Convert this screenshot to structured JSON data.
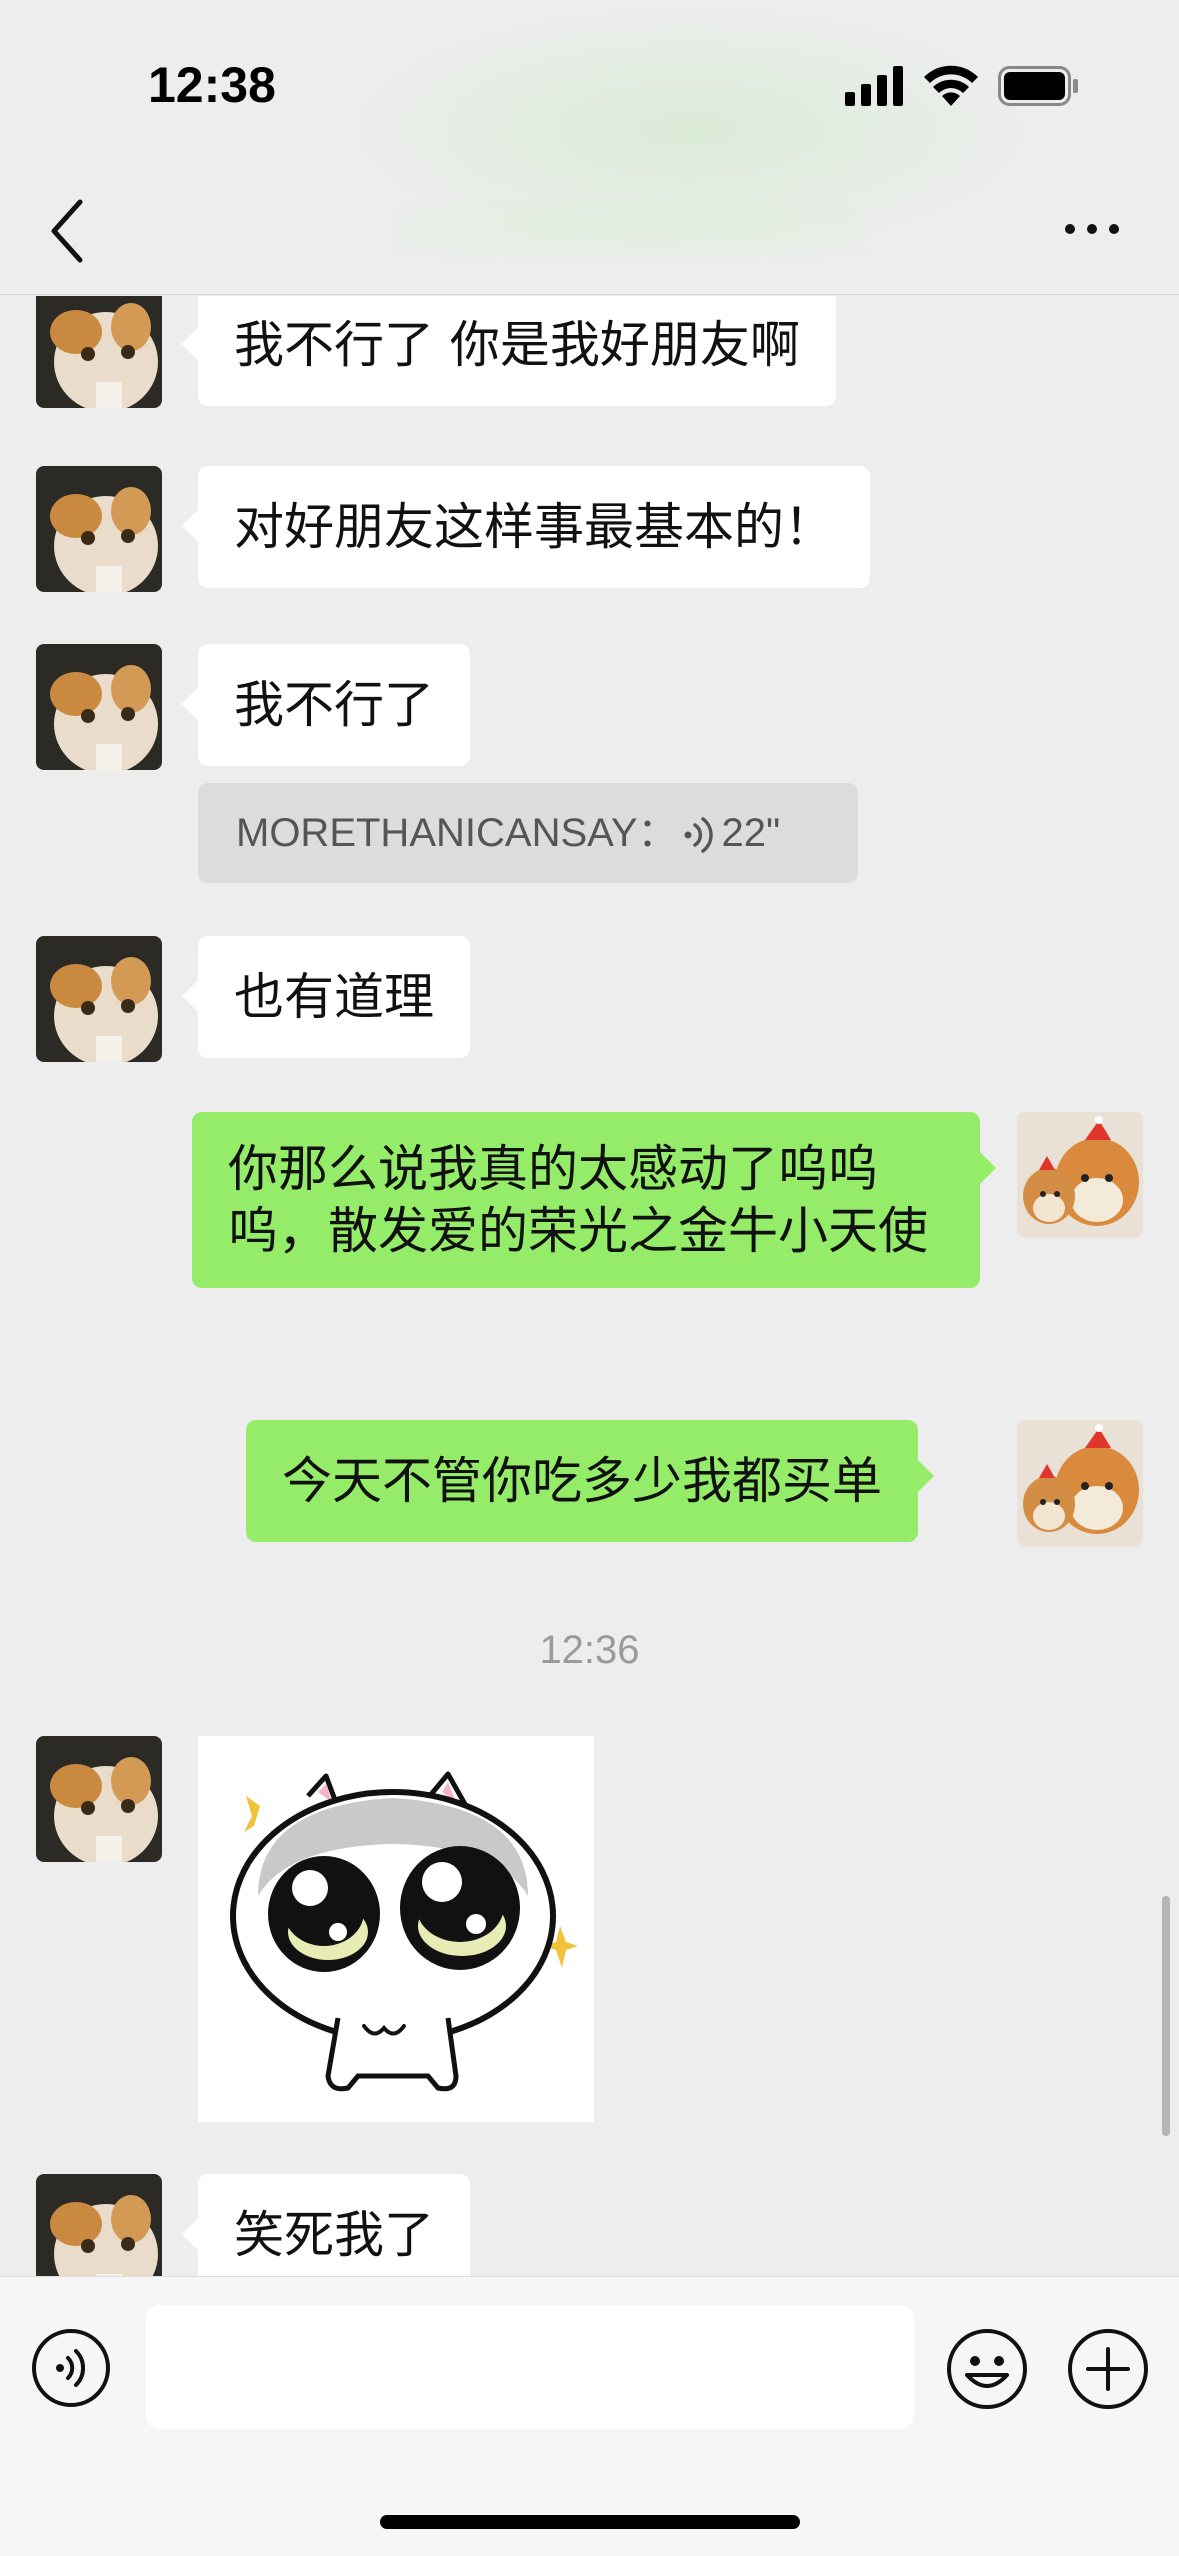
{
  "status_bar": {
    "time": "12:38"
  },
  "nav": {
    "title": ""
  },
  "messages": [
    {
      "id": "m1",
      "side": "left",
      "text": "我不行了 你是我好朋友啊"
    },
    {
      "id": "m2",
      "side": "left",
      "text": "对好朋友这样事最基本的！"
    },
    {
      "id": "m3",
      "side": "left",
      "text": "我不行了"
    },
    {
      "id": "m4",
      "side": "left",
      "text": "也有道理"
    },
    {
      "id": "m5",
      "side": "right",
      "text": "你那么说我真的太感动了呜呜呜，散发爱的荣光之金牛小天使"
    },
    {
      "id": "m6",
      "side": "right",
      "text": "今天不管你吃多少我都买单"
    },
    {
      "id": "m8",
      "side": "left",
      "text": "笑死我了"
    }
  ],
  "voice_transcript": {
    "text": "MORETHANICANSAY：",
    "duration": "22\""
  },
  "timestamp": "12:36",
  "input": {
    "value": "",
    "placeholder": ""
  },
  "colors": {
    "background": "#ededed",
    "sent_bubble": "#95ec69",
    "received_bubble": "#ffffff"
  }
}
